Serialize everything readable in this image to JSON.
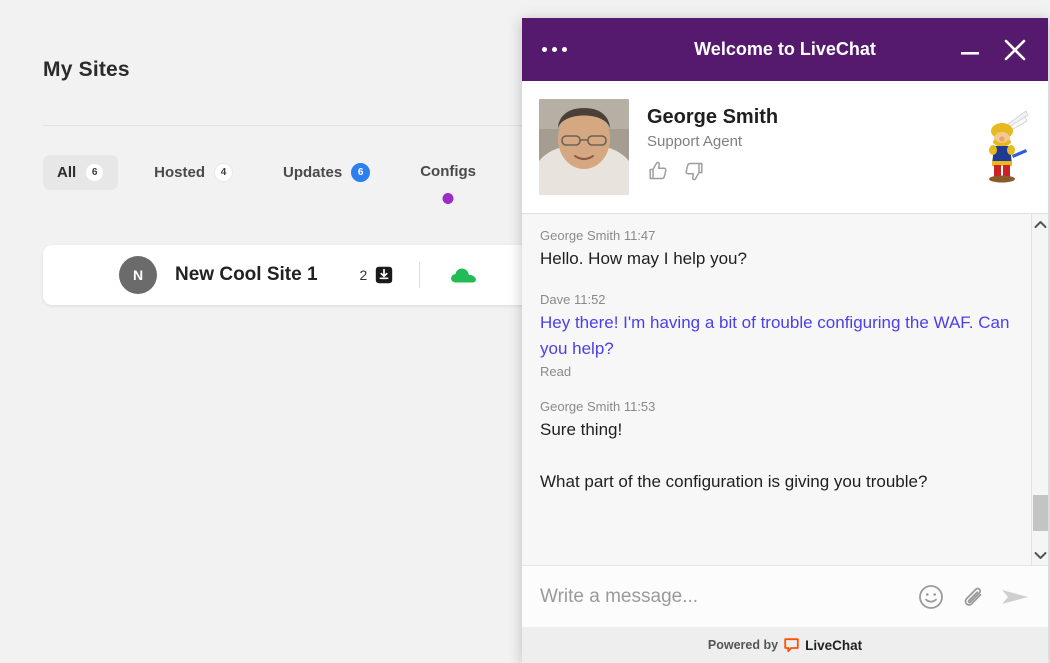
{
  "background_app": {
    "page_title": "My Sites",
    "tabs": [
      {
        "label": "All",
        "badge": "6",
        "badge_style": "plain",
        "active": true,
        "dot": false
      },
      {
        "label": "Hosted",
        "badge": "4",
        "badge_style": "plain",
        "active": false,
        "dot": false
      },
      {
        "label": "Updates",
        "badge": "6",
        "badge_style": "blue",
        "active": false,
        "dot": false
      },
      {
        "label": "Configs",
        "badge": "",
        "badge_style": "none",
        "active": false,
        "dot": true
      }
    ],
    "site_row": {
      "avatar_letter": "N",
      "name": "New Cool Site 1",
      "update_count": "2",
      "download_icon": "download-icon",
      "status_icon": "cloud-icon"
    }
  },
  "chat": {
    "header": {
      "menu_icon": "ellipsis-icon",
      "title": "Welcome to LiveChat",
      "minimize_icon": "minimize-icon",
      "close_icon": "close-icon"
    },
    "agent": {
      "avatar": "agent-photo",
      "name": "George Smith",
      "role": "Support Agent",
      "thumbs_up_icon": "thumbs-up-icon",
      "thumbs_down_icon": "thumbs-down-icon",
      "mascot_icon": "mascot-icon"
    },
    "messages": [
      {
        "author": "George Smith",
        "time": "11:47",
        "meta": "George Smith 11:47",
        "text": "Hello. How may I help you?",
        "side": "agent",
        "status": ""
      },
      {
        "author": "Dave",
        "time": "11:52",
        "meta": "Dave 11:52",
        "text": "Hey there! I'm having a bit of trouble configuring the WAF. Can you help?",
        "side": "visitor",
        "status": "Read"
      },
      {
        "author": "George Smith",
        "time": "11:53",
        "meta": "George Smith 11:53",
        "text": "Sure thing!\n\nWhat part of the configuration is giving you trouble?",
        "side": "agent",
        "status": ""
      }
    ],
    "scrollbar": {
      "up_icon": "chevron-up-icon",
      "down_icon": "chevron-down-icon"
    },
    "composer": {
      "placeholder": "Write a message...",
      "value": "",
      "emoji_icon": "smiley-icon",
      "attach_icon": "paperclip-icon",
      "send_icon": "send-icon"
    },
    "footer": {
      "powered_by": "Powered by",
      "brand": "LiveChat",
      "brand_icon": "livechat-logo-icon"
    }
  },
  "colors": {
    "chat_header_purple": "#551a6e",
    "visitor_text_blue": "#4b3fe8",
    "updates_badge_blue": "#2d7ff0",
    "configs_dot_purple": "#9b2fc4",
    "cloud_green": "#22bb55",
    "page_background": "#f2f2f2"
  }
}
